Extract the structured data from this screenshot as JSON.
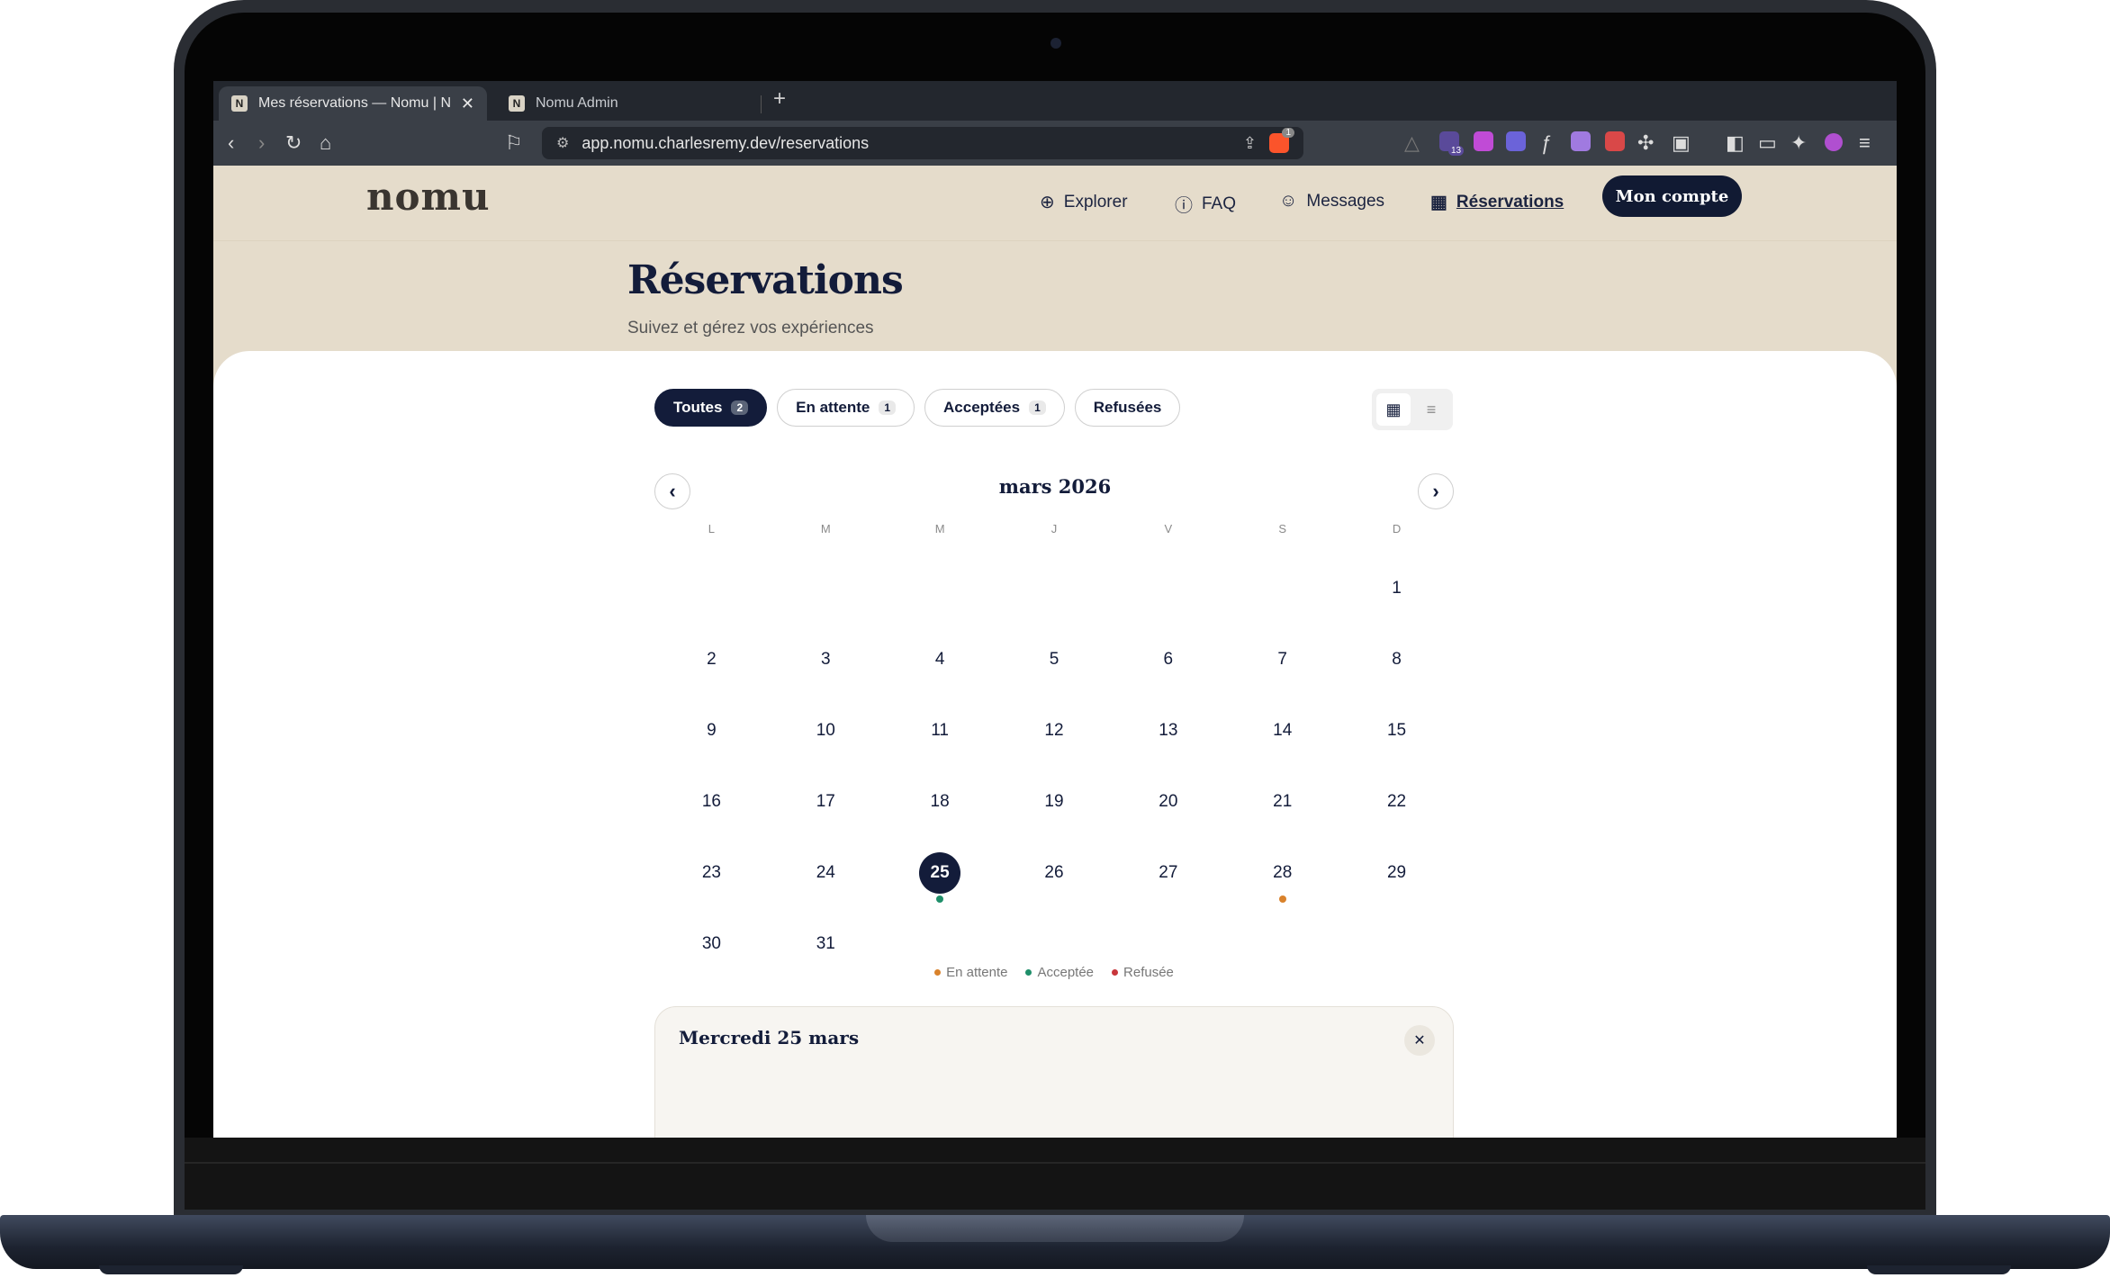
{
  "browser": {
    "tabs": [
      {
        "title": "Mes réservations — Nomu | Nomu",
        "favicon": "N"
      },
      {
        "title": "Nomu Admin",
        "favicon": "N"
      }
    ],
    "url_host": "app.nomu.charlesremy.dev",
    "url_path": "/reservations",
    "brave_badge": "1",
    "ext_badge": "13"
  },
  "site": {
    "logo": "nomu",
    "nav": [
      {
        "label": "Explorer",
        "icon": "globe-icon"
      },
      {
        "label": "FAQ",
        "icon": "help-icon"
      },
      {
        "label": "Messages",
        "icon": "chat-icon"
      },
      {
        "label": "Réservations",
        "icon": "calendar-icon"
      }
    ],
    "account_label": "Mon compte"
  },
  "page": {
    "title": "Réservations",
    "subtitle": "Suivez et gérez vos expériences"
  },
  "filters": [
    {
      "label": "Toutes",
      "count": "2",
      "active": true
    },
    {
      "label": "En attente",
      "count": "1"
    },
    {
      "label": "Acceptées",
      "count": "1"
    },
    {
      "label": "Refusées",
      "count": ""
    }
  ],
  "calendar": {
    "month_label": "mars 2026",
    "weekdays": [
      "L",
      "M",
      "M",
      "J",
      "V",
      "S",
      "D"
    ],
    "leading_blanks": 6,
    "days_in_month": 31,
    "today": 25,
    "markers": {
      "25": "accepted",
      "28": "pending"
    }
  },
  "legend": [
    {
      "key": "pending",
      "label": "En attente",
      "color": "#d9822b"
    },
    {
      "key": "accepted",
      "label": "Acceptée",
      "color": "#1f8f6a"
    },
    {
      "key": "refused",
      "label": "Refusée",
      "color": "#c8363b"
    }
  ],
  "day_panel": {
    "title": "Mercredi 25 mars"
  }
}
